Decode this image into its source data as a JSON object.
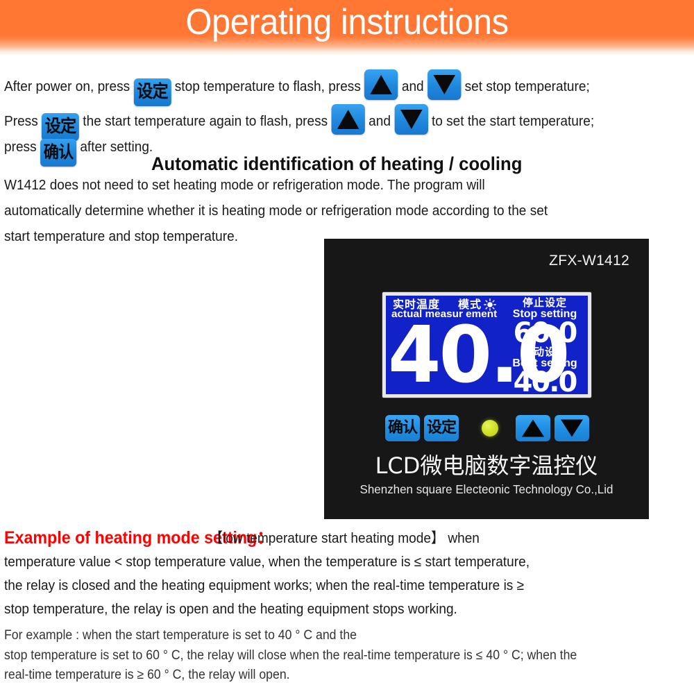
{
  "header": {
    "title": "Operating instructions",
    "bg_color": "#ff7733",
    "text_color": "#ffffff"
  },
  "instructions": {
    "line1_part1": "After power on, press",
    "line1_key": "设定",
    "line1_part2": "stop temperature to flash, press",
    "line1_and": "and",
    "line1_part3": "set stop temperature;",
    "line2_part1": "Press",
    "line2_key": "设定",
    "line2_part2": "the start temperature again to flash, press",
    "line2_and": "and",
    "line2_part3": "to set the start temperature;",
    "line3_part1": "press",
    "line3_key": "确认",
    "line3_part2": "after setting.",
    "up_icon": "triangle-up-icon",
    "down_icon": "triangle-down-icon"
  },
  "auto_section": {
    "heading": "Automatic identification of heating / cooling",
    "para_line1": "W1412  does not need to set heating mode or refrigeration mode. The program will",
    "para_line2": "automatically determine whether it is heating mode or refrigeration mode according to the set",
    "para_line3": "start temperature and stop temperature."
  },
  "device": {
    "model": "ZFX-W1412",
    "lcd": {
      "actual_label_cn": "实时温度",
      "mode_label_cn": "模式",
      "sun_icon": "sun-icon",
      "actual_label_en": "actual measur ement",
      "main_value": "40.0",
      "stop_label_cn": "停止设定",
      "stop_label_en": "Stop setting",
      "stop_value": "60.0",
      "boot_label_cn": "启动设定",
      "boot_label_en": "Boot setting",
      "boot_value": "40.0",
      "screen_color": "#1022c8",
      "segment_color": "#ffffff"
    },
    "buttons": {
      "confirm": "确认",
      "set": "设定",
      "up_icon": "triangle-up-icon",
      "down_icon": "triangle-down-icon",
      "led_icon": "led-indicator-icon",
      "led_color": "#d2e32a"
    },
    "brand_cn": "LCD微电脑数字温控仪",
    "brand_en": "Shenzhen square Electeonic Technology Co.,Lid",
    "panel_color": "#171717"
  },
  "example": {
    "heading": "Example of heating mode setting：",
    "heading_color": "#ff0000",
    "line1_tail": "【low temperature start heating mode】 when",
    "line2": "temperature value < stop temperature value, when the temperature is ≤ start temperature,",
    "line3": "the relay is closed and the heating equipment works; when the real-time temperature is ≥",
    "line4": "stop temperature, the relay is open and the heating equipment stops working.",
    "line5": "For example :   when the start temperature is set to 40 ° C and the",
    "line6": "stop temperature is set to 60 ° C, the relay will close when the real-time temperature is ≤ 40 ° C; when the",
    "line7": "real-time temperature is ≥ 60 ° C, the relay will open."
  }
}
